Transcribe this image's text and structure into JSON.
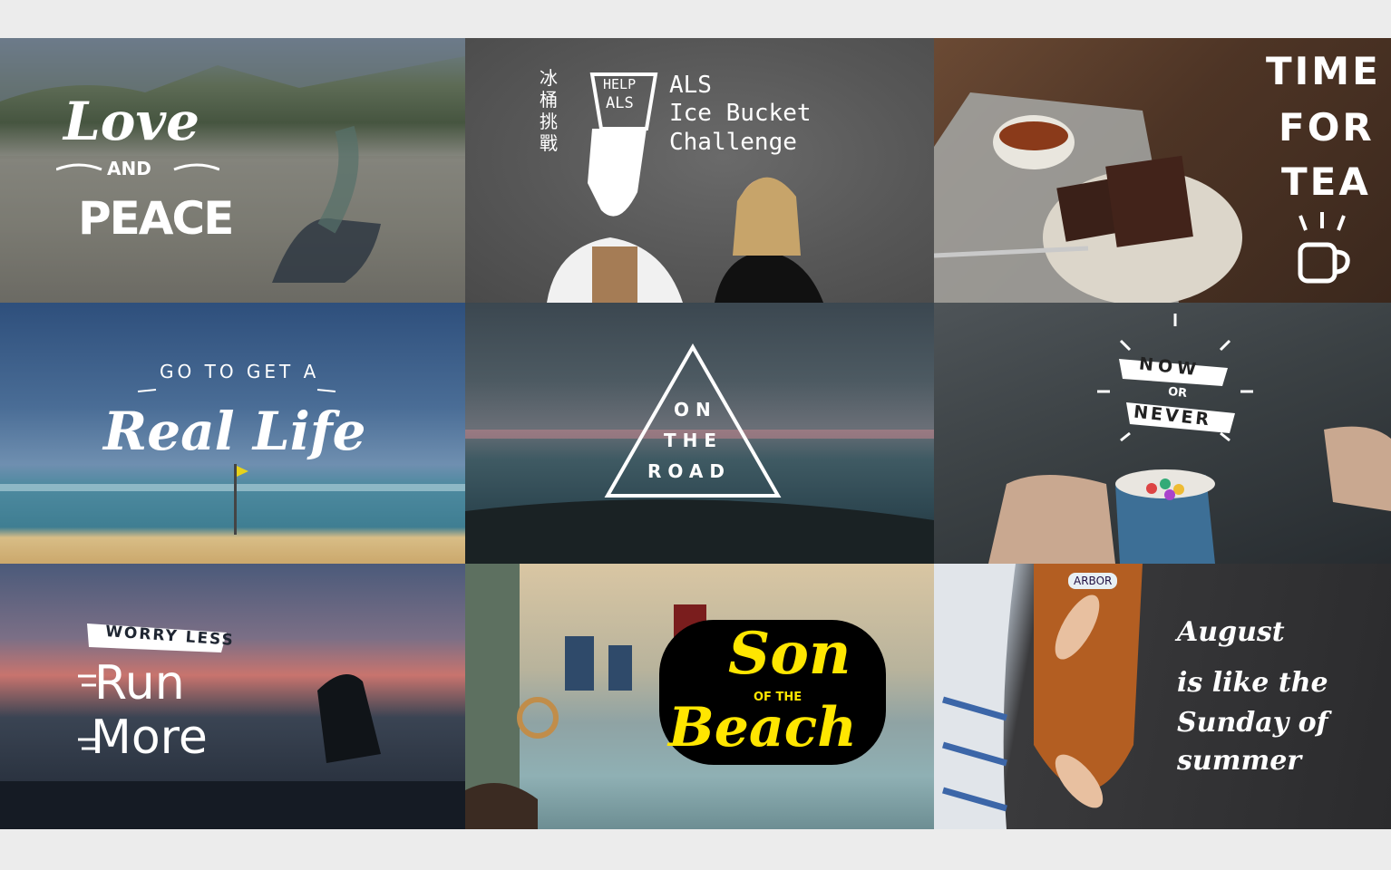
{
  "tiles": [
    {
      "id": "love-and-peace",
      "lines": [
        "Love",
        "AND",
        "PEACE"
      ]
    },
    {
      "id": "ice-bucket",
      "vertical_cn": "冰桶挑戰",
      "bucket": [
        "HELP",
        "ALS"
      ],
      "title": [
        "ALS",
        "Ice Bucket",
        "Challenge"
      ]
    },
    {
      "id": "time-for-tea",
      "lines": [
        "TIME",
        "FOR",
        "TEA"
      ],
      "icon": "coffee-mug-icon"
    },
    {
      "id": "real-life",
      "arc": "GO TO GET A",
      "script": "Real Life"
    },
    {
      "id": "on-the-road",
      "lines": [
        "ON",
        "THE",
        "ROAD"
      ],
      "icon": "triangle-icon"
    },
    {
      "id": "now-or-never",
      "lines": [
        "NOW",
        "OR",
        "NEVER"
      ]
    },
    {
      "id": "run-more",
      "banner": "WORRY LESS",
      "lines": [
        "Run",
        "More"
      ]
    },
    {
      "id": "son-of-the-beach",
      "lines": [
        "Son",
        "OF THE",
        "Beach"
      ],
      "accent": "#ffe600"
    },
    {
      "id": "august",
      "lines": [
        "August",
        "is like the",
        "Sunday of",
        "summer"
      ],
      "board_label": "ARBOR"
    }
  ]
}
